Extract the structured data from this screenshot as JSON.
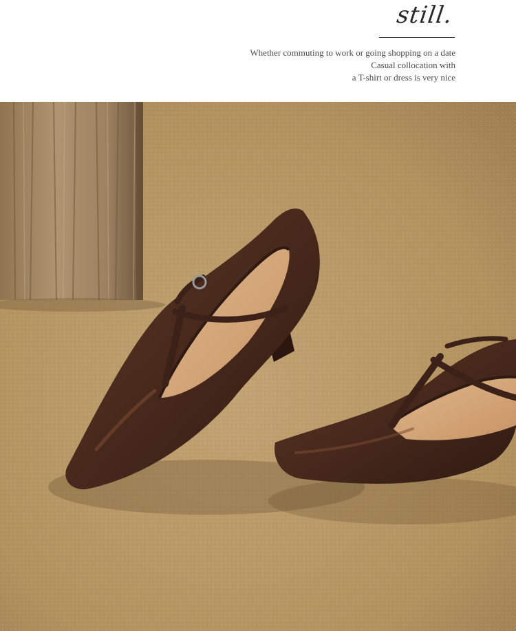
{
  "header": {
    "title": "still.",
    "caption_lines": [
      "Whether commuting to work or going shopping on a date",
      "Casual collocation with",
      "a T-shirt or dress is very nice"
    ]
  },
  "photo": {
    "subject": "brown-leather-t-strap-pumps",
    "colors": {
      "carpet": "#b7996a",
      "wood": "#a88a60",
      "leather": "#4a2a1e",
      "lining": "#d2a57a"
    }
  }
}
